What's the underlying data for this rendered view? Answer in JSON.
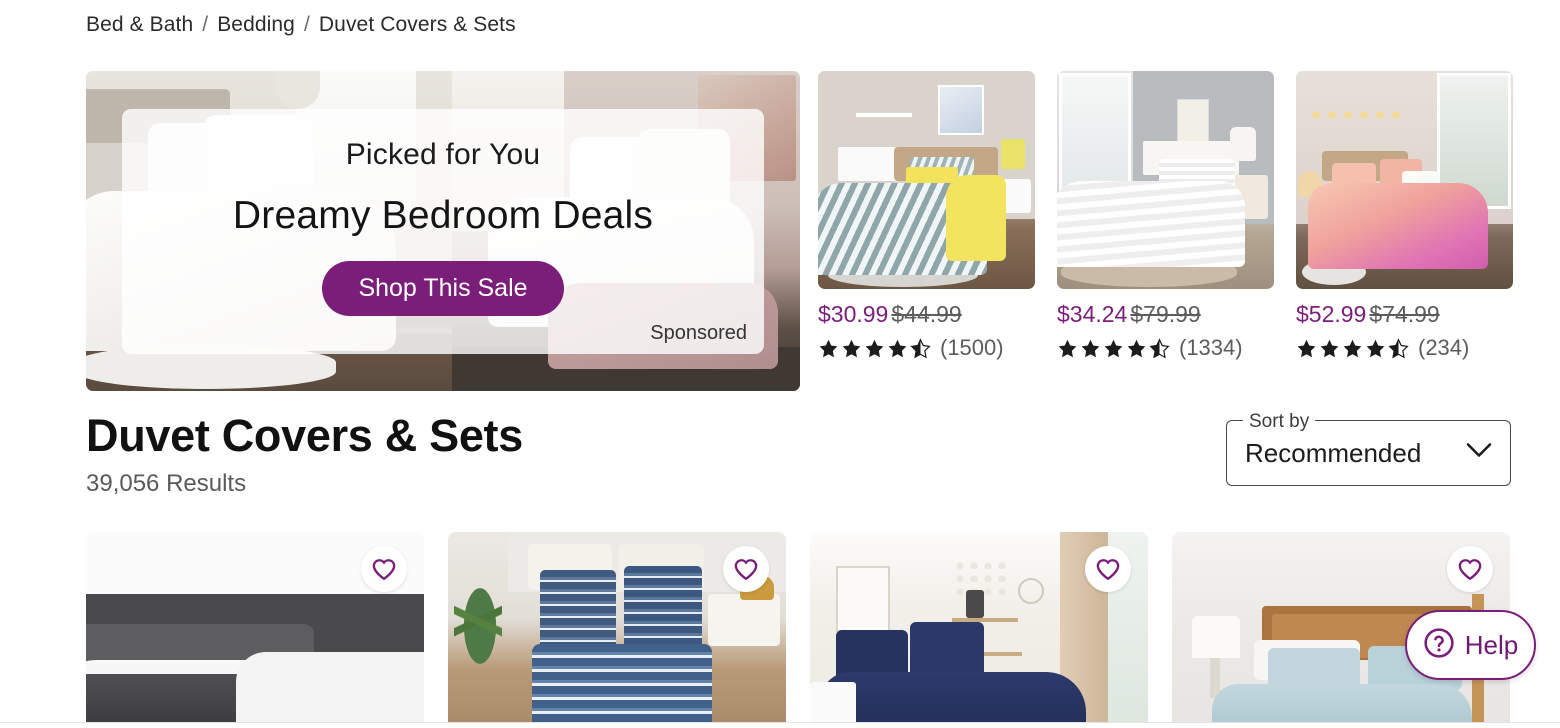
{
  "breadcrumb": {
    "items": [
      "Bed & Bath",
      "Bedding",
      "Duvet Covers & Sets"
    ],
    "separator": "/"
  },
  "hero_banner": {
    "kicker": "Picked for You",
    "title": "Dreamy Bedroom Deals",
    "cta_label": "Shop This Sale",
    "sponsored_label": "Sponsored",
    "accent_color": "#7b1e7a"
  },
  "sponsored_products": [
    {
      "price": "$30.99",
      "was_price": "$44.99",
      "rating": 4.5,
      "review_count": "(1500)",
      "image_alt": "grey-chevron-yellow-bedding"
    },
    {
      "price": "$34.24",
      "was_price": "$79.99",
      "rating": 4.5,
      "review_count": "(1334)",
      "image_alt": "white-ruffle-bedding"
    },
    {
      "price": "$52.99",
      "was_price": "$74.99",
      "rating": 4.5,
      "review_count": "(234)",
      "image_alt": "pink-ombre-bedding"
    }
  ],
  "listing": {
    "title": "Duvet Covers & Sets",
    "results_count": "39,056 Results"
  },
  "sort": {
    "label": "Sort by",
    "selected": "Recommended",
    "chevron_icon": "chevron-down-icon"
  },
  "product_grid": [
    {
      "image_alt": "grey-white-duvet",
      "favorite_icon": "heart-icon"
    },
    {
      "image_alt": "navy-geometric-duvet",
      "favorite_icon": "heart-icon"
    },
    {
      "image_alt": "navy-blue-duvet",
      "favorite_icon": "heart-icon"
    },
    {
      "image_alt": "light-blue-duvet",
      "favorite_icon": "heart-icon"
    }
  ],
  "help_widget": {
    "label": "Help",
    "icon": "question-circle-icon",
    "accent_color": "#7b1e7a"
  }
}
